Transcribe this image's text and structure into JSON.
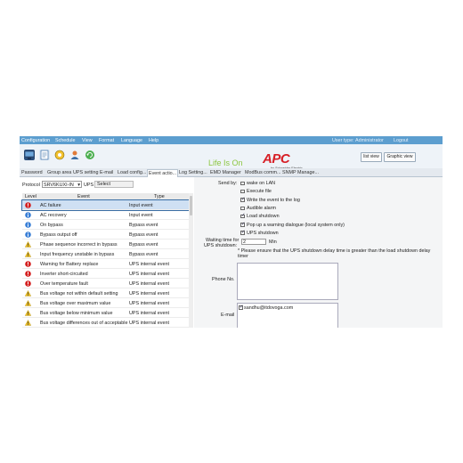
{
  "menu": {
    "items": [
      "Configuration",
      "Schedule",
      "View",
      "Format",
      "Language",
      "Help"
    ],
    "user_type_label": "User type:",
    "user_type_value": "Administrator",
    "logout": "Logout"
  },
  "toolbar": {
    "icons": [
      "computer-icon",
      "report-icon",
      "status-icon",
      "user-icon",
      "refresh-icon"
    ],
    "brand_tagline": "Life Is On",
    "apc_logo": "APC",
    "apc_sub": "by Schneider Electric",
    "list_view": "list view",
    "graphic_view": "Graphic view"
  },
  "tabs": [
    "Password",
    "Group area",
    "UPS setting",
    "E-mail",
    "Load config...",
    "Event actio...",
    "Log Setting...",
    "EMD Manager",
    "ModBus comm...",
    "SNMP Manage..."
  ],
  "left": {
    "protocol_label": "Protocol",
    "protocol_value": "SRV6KUXI-IN",
    "ups_label": "UPS",
    "select_label": "Select",
    "col_level": "Level",
    "col_event": "Event",
    "col_type": "Type",
    "rows": [
      {
        "level": "critical",
        "event": "AC failure",
        "type": "Input event"
      },
      {
        "level": "info",
        "event": "AC recovery",
        "type": "Input event"
      },
      {
        "level": "info",
        "event": "On bypass",
        "type": "Bypass event"
      },
      {
        "level": "info",
        "event": "Bypass output off",
        "type": "Bypass event"
      },
      {
        "level": "warning",
        "event": "Phase sequence incorrect in bypass",
        "type": "Bypass event"
      },
      {
        "level": "warning",
        "event": "Input frequency unstable in bypass",
        "type": "Bypass event"
      },
      {
        "level": "critical",
        "event": "Warning for Battery replace",
        "type": "UPS internal event"
      },
      {
        "level": "critical",
        "event": "Inverter short-circuited",
        "type": "UPS internal event"
      },
      {
        "level": "critical",
        "event": "Over temperature fault",
        "type": "UPS internal event"
      },
      {
        "level": "warning",
        "event": "Bus voltage not within default setting",
        "type": "UPS internal event"
      },
      {
        "level": "warning",
        "event": "Bus voltage over maximum value",
        "type": "UPS internal event"
      },
      {
        "level": "warning",
        "event": "Bus voltage below minimum value",
        "type": "UPS internal event"
      },
      {
        "level": "warning",
        "event": "Bus voltage differences out of acceptable ra",
        "type": "UPS internal event"
      },
      {
        "level": "warning",
        "event": "Bus voltage of slope rate drops too fast",
        "type": "UPS internal event"
      }
    ]
  },
  "right": {
    "send_by_label": "Send by:",
    "options": [
      {
        "label": "wake on LAN",
        "checked": false
      },
      {
        "label": "Execute file",
        "checked": false
      },
      {
        "label": "Write the event to the log",
        "checked": true
      },
      {
        "label": "Audible alarm",
        "checked": false
      },
      {
        "label": "Load shutdown",
        "checked": true
      },
      {
        "label": "Pop up a warning dialogue (local system only)",
        "checked": true
      },
      {
        "label": "UPS shutdown",
        "checked": true
      }
    ],
    "waiting_label_1": "Waiting time for",
    "waiting_label_2": "UPS shutdown:",
    "waiting_value": "2",
    "waiting_unit": "Min",
    "note_1": "* Please ensure that the UPS shutdown delay time is greater than the load shutdown delay",
    "note_2": "timer",
    "phone_label": "Phone No.",
    "email_label": "E-mail",
    "email_value": "sandhu@itdovoga.com",
    "email_checked": true
  },
  "colors": {
    "menubar": "#5c9ecf",
    "critical": "#d42020",
    "info": "#3a7fd6",
    "warning": "#f0c020",
    "lifeison": "#8cc63f",
    "apc": "#d71f26"
  }
}
